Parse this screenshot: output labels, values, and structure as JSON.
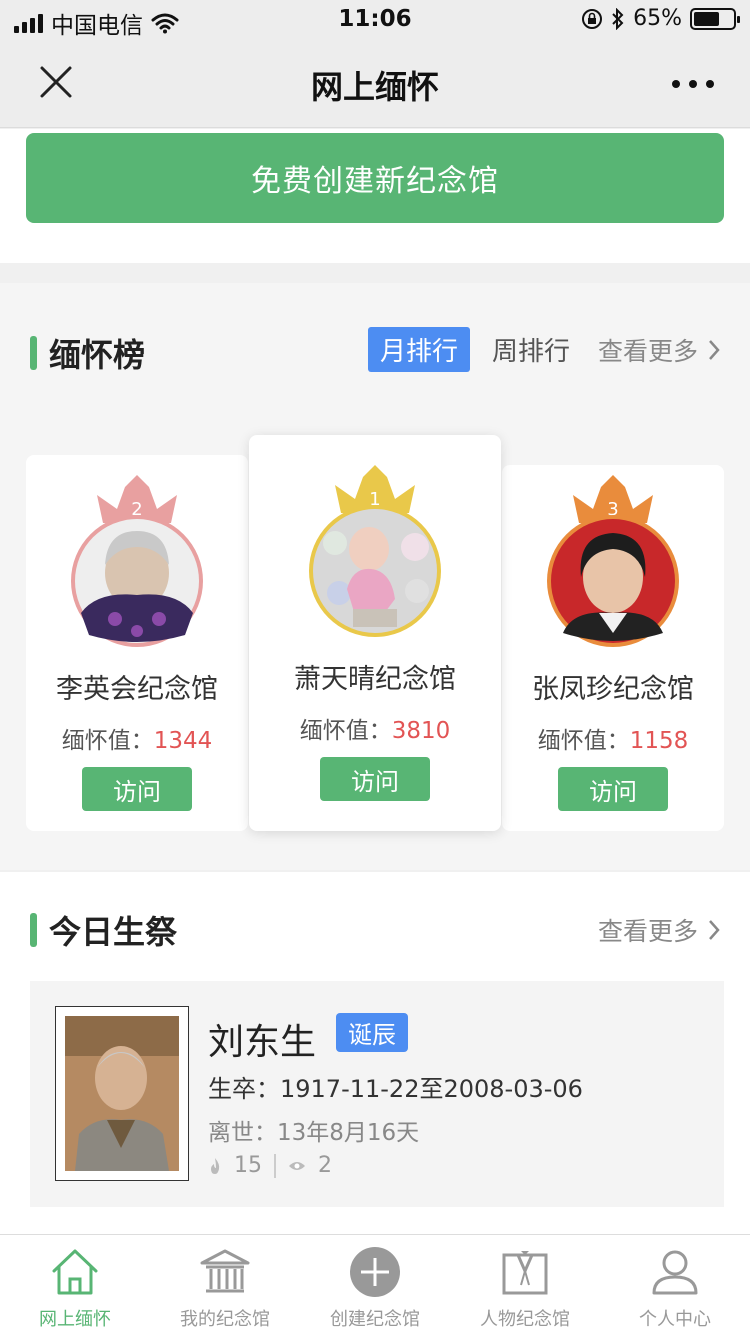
{
  "status": {
    "carrier": "中国电信",
    "time": "11:06",
    "battery": "65%",
    "battery_level": 0.65
  },
  "nav": {
    "title": "网上缅怀"
  },
  "create": {
    "label": "免费创建新纪念馆"
  },
  "ranking": {
    "title": "缅怀榜",
    "tabs": [
      "月排行",
      "周排行"
    ],
    "active_tab": "月排行",
    "more": "查看更多",
    "score_label": "缅怀值：",
    "visit_label": "访问",
    "cards": [
      {
        "rank": "2",
        "name": "李英会纪念馆",
        "score": "1344",
        "crown_color": "#e8a0a0"
      },
      {
        "rank": "1",
        "name": "萧天晴纪念馆",
        "score": "3810",
        "crown_color": "#e9c84a"
      },
      {
        "rank": "3",
        "name": "张凤珍纪念馆",
        "score": "1158",
        "crown_color": "#e98c3c"
      }
    ]
  },
  "birthday": {
    "title": "今日生祭",
    "more": "查看更多",
    "person": {
      "name": "刘东生",
      "badge": "诞辰",
      "dates": "生卒：1917-11-22至2008-03-06",
      "passed": "离世：13年8月16天",
      "flames": "15",
      "views": "2"
    }
  },
  "tabbar": {
    "items": [
      "网上缅怀",
      "我的纪念馆",
      "创建纪念馆",
      "人物纪念馆",
      "个人中心"
    ],
    "active": "网上缅怀"
  },
  "colors": {
    "accent_green": "#58b574",
    "accent_blue": "#4d8df2",
    "score_red": "#e25454"
  }
}
